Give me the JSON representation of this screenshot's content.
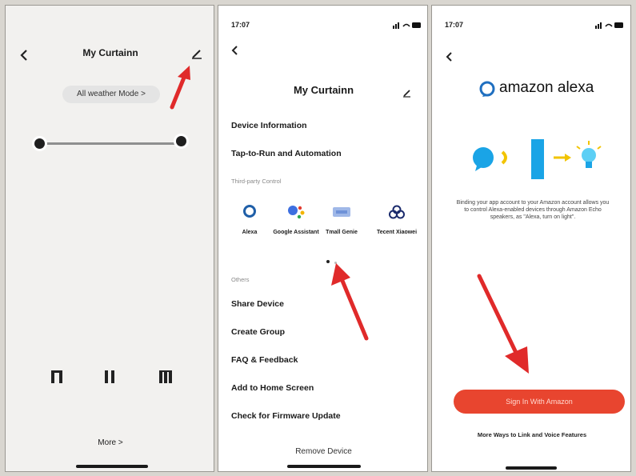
{
  "panel1": {
    "title": "My Curtainn",
    "mode_label": "All weather Mode >",
    "more_label": "More >",
    "icons": [
      "back-arrow-icon",
      "edit-pencil-icon",
      "curtain-open-icon",
      "pause-icon",
      "curtain-close-icon"
    ]
  },
  "panel2": {
    "status_time": "17:07",
    "title": "My Curtainn",
    "menu_top": [
      "Device Information",
      "Tap-to-Run and Automation"
    ],
    "section_third_party": "Third-party Control",
    "third_party": [
      {
        "label": "Alexa",
        "icon": "alexa-ring-icon"
      },
      {
        "label": "Google Assistant",
        "icon": "google-assistant-icon"
      },
      {
        "label": "Tmall Genie",
        "icon": "tmall-genie-icon"
      },
      {
        "label": "Tecent Xiaowei",
        "icon": "tencent-xiaowei-icon"
      }
    ],
    "section_others": "Others",
    "menu_bottom": [
      "Share Device",
      "Create Group",
      "FAQ & Feedback",
      "Add to Home Screen",
      "Check for Firmware Update"
    ],
    "remove_label": "Remove Device"
  },
  "panel3": {
    "status_time": "17:07",
    "logo_text": "amazon alexa",
    "description": "Binding your app account to your Amazon account allows you to control Alexa-enabled devices through Amazon Echo speakers, as \"Alexa, turn on light\".",
    "signin_label": "Sign In With Amazon",
    "more_ways_label": "More Ways to Link and Voice Features"
  },
  "colors": {
    "arrow": "#e02a2a",
    "signin_button": "#e8452f",
    "alexa_blue": "#1aa4e6",
    "bulb_yellow": "#f2c400"
  }
}
